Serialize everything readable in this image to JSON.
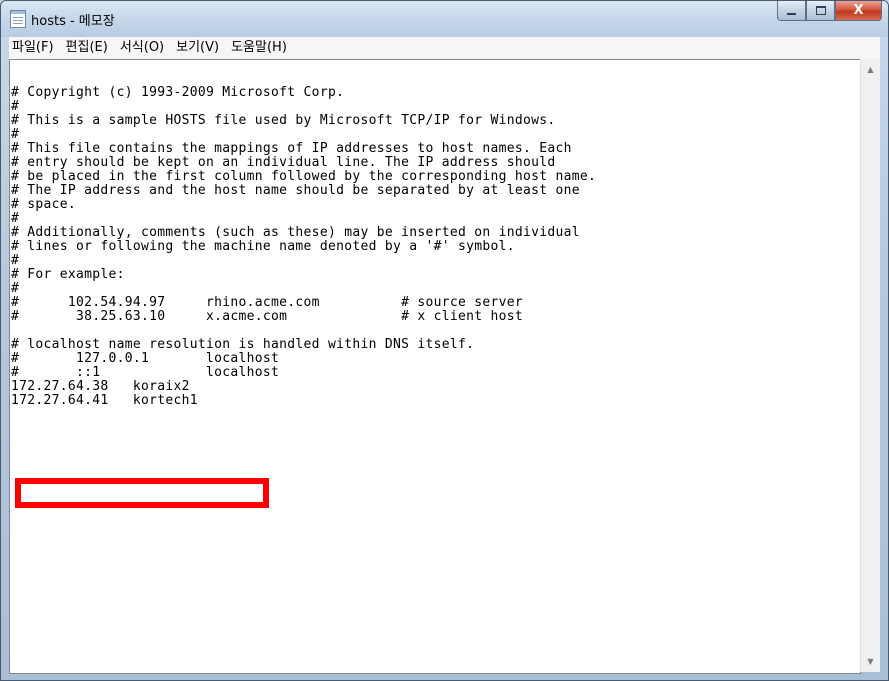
{
  "window": {
    "title": "hosts - 메모장",
    "controls": {
      "minimize": "—",
      "maximize": "□",
      "close": "X"
    }
  },
  "menubar": {
    "items": [
      "파일(F)",
      "편집(E)",
      "서식(O)",
      "보기(V)",
      "도움말(H)"
    ]
  },
  "editor": {
    "lines": [
      "# Copyright (c) 1993-2009 Microsoft Corp.",
      "#",
      "# This is a sample HOSTS file used by Microsoft TCP/IP for Windows.",
      "#",
      "# This file contains the mappings of IP addresses to host names. Each",
      "# entry should be kept on an individual line. The IP address should",
      "# be placed in the first column followed by the corresponding host name.",
      "# The IP address and the host name should be separated by at least one",
      "# space.",
      "#",
      "# Additionally, comments (such as these) may be inserted on individual",
      "# lines or following the machine name denoted by a '#' symbol.",
      "#",
      "# For example:",
      "#",
      "#      102.54.94.97     rhino.acme.com          # source server",
      "#       38.25.63.10     x.acme.com              # x client host",
      "",
      "# localhost name resolution is handled within DNS itself.",
      "#\t127.0.0.1       localhost",
      "#\t::1             localhost",
      "172.27.64.38   koraix2",
      "172.27.64.41   kortech1"
    ]
  },
  "highlight": {
    "color": "#ff0000"
  },
  "scrollbar": {
    "up_icon": "▲",
    "down_icon": "▼"
  }
}
